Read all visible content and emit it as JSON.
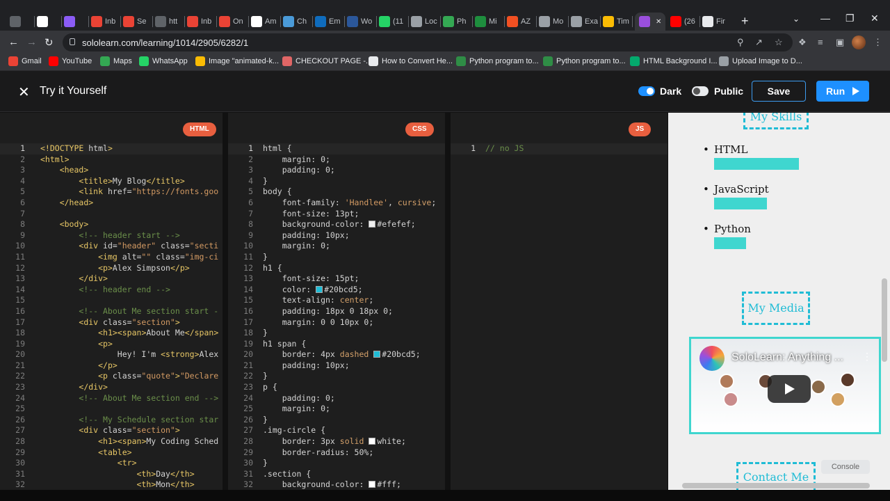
{
  "browser": {
    "tabs": [
      {
        "label": "",
        "icon": "settings-tab-icon",
        "color": "#5f6368"
      },
      {
        "label": "",
        "icon": "google-icon",
        "color": "#ffffff"
      },
      {
        "label": "",
        "icon": "protonvpn-icon",
        "color": "#8b5cf6"
      },
      {
        "label": "Inb",
        "icon": "gmail-icon",
        "color": "#ea4335"
      },
      {
        "label": "Se",
        "icon": "gmail-icon",
        "color": "#ea4335"
      },
      {
        "label": "htt",
        "icon": "globe-icon",
        "color": "#5f6368"
      },
      {
        "label": "Inb",
        "icon": "gmail-icon",
        "color": "#ea4335"
      },
      {
        "label": "On",
        "icon": "gmail-icon",
        "color": "#ea4335"
      },
      {
        "label": "Am",
        "icon": "amazon-icon",
        "color": "#ffffff"
      },
      {
        "label": "Ch",
        "icon": "chat-icon",
        "color": "#4a9ad8"
      },
      {
        "label": "Em",
        "icon": "outlook-icon",
        "color": "#0f6cbd"
      },
      {
        "label": "Wo",
        "icon": "word-icon",
        "color": "#2b579a"
      },
      {
        "label": "(11",
        "icon": "whatsapp-icon",
        "color": "#25d366"
      },
      {
        "label": "Loc",
        "icon": "globe-icon",
        "color": "#9aa0a6"
      },
      {
        "label": "Ph",
        "icon": "google-drive-icon",
        "color": "#34a853"
      },
      {
        "label": "Mi",
        "icon": "green-app-icon",
        "color": "#1e8e3e"
      },
      {
        "label": "AZ",
        "icon": "microsoft-icon",
        "color": "#f25022"
      },
      {
        "label": "Mo",
        "icon": "printer-icon",
        "color": "#9aa0a6"
      },
      {
        "label": "Exa",
        "icon": "figure-icon",
        "color": "#9aa0a6"
      },
      {
        "label": "Tim",
        "icon": "timer-icon",
        "color": "#fbbc04"
      },
      {
        "label": "",
        "icon": "sololearn-icon",
        "color": "#9a4fdd",
        "active": true
      },
      {
        "label": "(26",
        "icon": "youtube-icon",
        "color": "#ff0000"
      },
      {
        "label": "Fir",
        "icon": "doc-icon",
        "color": "#e8eaed"
      }
    ],
    "url": "sololearn.com/learning/1014/2905/6282/1",
    "bookmarks": [
      {
        "label": "Gmail",
        "icon": "gmail-icon",
        "color": "#ea4335"
      },
      {
        "label": "YouTube",
        "icon": "youtube-icon",
        "color": "#ff0000"
      },
      {
        "label": "Maps",
        "icon": "maps-icon",
        "color": "#34a853"
      },
      {
        "label": "WhatsApp",
        "icon": "whatsapp-icon",
        "color": "#25d366"
      },
      {
        "label": "Image \"animated-k...",
        "icon": "star-icon",
        "color": "#fbbc04"
      },
      {
        "label": "CHECKOUT PAGE -...",
        "icon": "bookmark-icon",
        "color": "#e06666"
      },
      {
        "label": "How to Convert He...",
        "icon": "alpha-icon",
        "color": "#e8eaed"
      },
      {
        "label": "Python program to...",
        "icon": "gfg-icon",
        "color": "#2f8d46"
      },
      {
        "label": "Python program to...",
        "icon": "gfg-icon",
        "color": "#2f8d46"
      },
      {
        "label": "HTML Background I...",
        "icon": "w3schools-icon",
        "color": "#04aa6d"
      },
      {
        "label": "Upload Image to D...",
        "icon": "globe-icon",
        "color": "#9aa0a6"
      }
    ]
  },
  "app": {
    "title": "Try it Yourself",
    "dark_label": "Dark",
    "public_label": "Public",
    "save_label": "Save",
    "run_label": "Run",
    "accent": "#1e90ff"
  },
  "editors": {
    "html": {
      "badge": "HTML",
      "lines": [
        "<!DOCTYPE html>",
        "<html>",
        "    <head>",
        "        <title>My Blog</title>",
        "        <link href=\"https://fonts.goo",
        "    </head>",
        "",
        "    <body>",
        "        <!-- header start -->",
        "        <div id=\"header\" class=\"secti",
        "            <img alt=\"\" class=\"img-ci",
        "            <p>Alex Simpson</p>",
        "        </div>",
        "        <!-- header end -->",
        "",
        "        <!-- About Me section start -",
        "        <div class=\"section\">",
        "            <h1><span>About Me</span>",
        "            <p>",
        "                Hey! I'm <strong>Alex",
        "            </p>",
        "            <p class=\"quote\">\"Declare",
        "        </div>",
        "        <!-- About Me section end -->",
        "",
        "        <!-- My Schedule section star",
        "        <div class=\"section\">",
        "            <h1><span>My Coding Sched",
        "            <table>",
        "                <tr>",
        "                    <th>Day</th>",
        "                    <th>Mon</th>"
      ]
    },
    "css": {
      "badge": "CSS",
      "lines": [
        "html {",
        "    margin: 0;",
        "    padding: 0;",
        "}",
        "body {",
        "    font-family: 'Handlee', cursive;",
        "    font-size: 13pt;",
        "    background-color: #efefef;",
        "    padding: 10px;",
        "    margin: 0;",
        "}",
        "h1 {",
        "    font-size: 15pt;",
        "    color: #20bcd5;",
        "    text-align: center;",
        "    padding: 18px 0 18px 0;",
        "    margin: 0 0 10px 0;",
        "}",
        "h1 span {",
        "    border: 4px dashed #20bcd5;",
        "    padding: 10px;",
        "}",
        "p {",
        "    padding: 0;",
        "    margin: 0;",
        "}",
        ".img-circle {",
        "    border: 3px solid white;",
        "    border-radius: 50%;",
        "}",
        ".section {",
        "    background-color: #fff;"
      ],
      "swatches": {
        "8": "#efefef",
        "14": "#20bcd5",
        "20": "#20bcd5",
        "28": "#ffffff",
        "32": "#ffffff"
      }
    },
    "js": {
      "badge": "JS",
      "lines": [
        "// no JS"
      ]
    }
  },
  "preview": {
    "skills_heading": "My Skills",
    "skills": [
      {
        "name": "HTML",
        "level": 0.9
      },
      {
        "name": "JavaScript",
        "level": 0.56
      },
      {
        "name": "Python",
        "level": 0.34
      }
    ],
    "media_heading": "My Media",
    "video_title": "SoloLearn: Anything ...",
    "contact_heading": "Contact Me",
    "console_label": "Console",
    "accent": "#20bcd5",
    "bar_color": "#3fd6cf"
  }
}
